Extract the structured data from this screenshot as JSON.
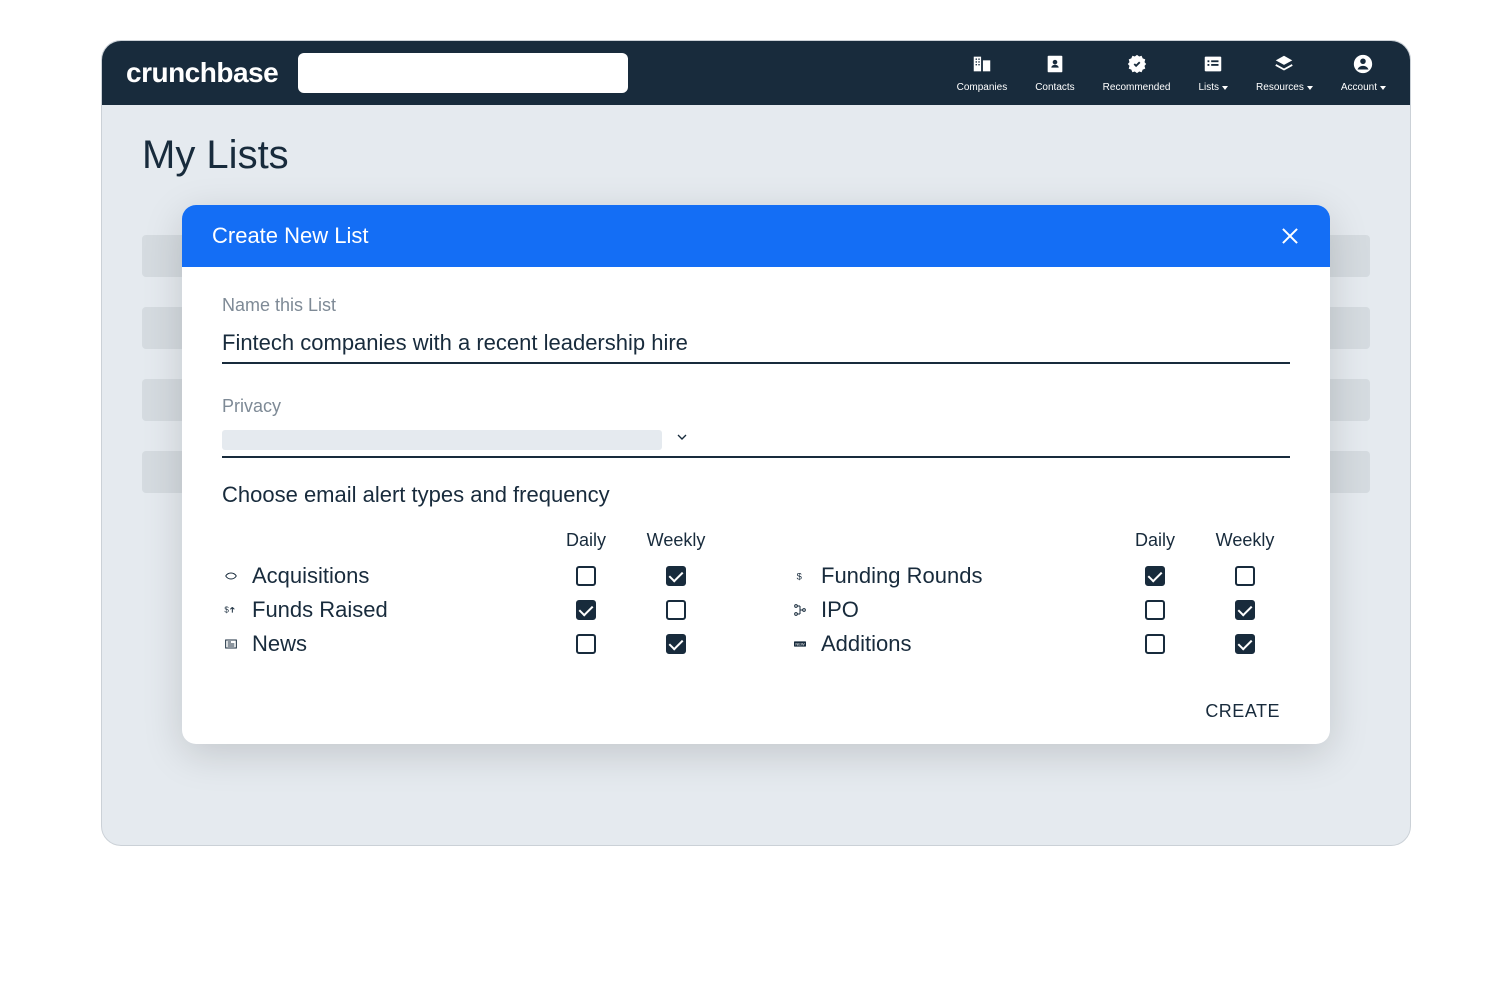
{
  "brand": "crunchbase",
  "nav": {
    "companies": "Companies",
    "contacts": "Contacts",
    "recommended": "Recommended",
    "lists": "Lists",
    "resources": "Resources",
    "account": "Account"
  },
  "page": {
    "title": "My Lists"
  },
  "modal": {
    "title": "Create New List",
    "name_label": "Name this List",
    "name_value": "Fintech companies with a recent leadership hire",
    "privacy_label": "Privacy",
    "alerts_heading": "Choose email alert types and frequency",
    "col_daily": "Daily",
    "col_weekly": "Weekly",
    "create_label": "CREATE",
    "left": [
      {
        "label": "Acquisitions",
        "daily": false,
        "weekly": true
      },
      {
        "label": "Funds Raised",
        "daily": true,
        "weekly": false
      },
      {
        "label": "News",
        "daily": false,
        "weekly": true
      }
    ],
    "right": [
      {
        "label": "Funding Rounds",
        "daily": true,
        "weekly": false
      },
      {
        "label": "IPO",
        "daily": false,
        "weekly": true
      },
      {
        "label": "Additions",
        "daily": false,
        "weekly": true
      }
    ]
  }
}
